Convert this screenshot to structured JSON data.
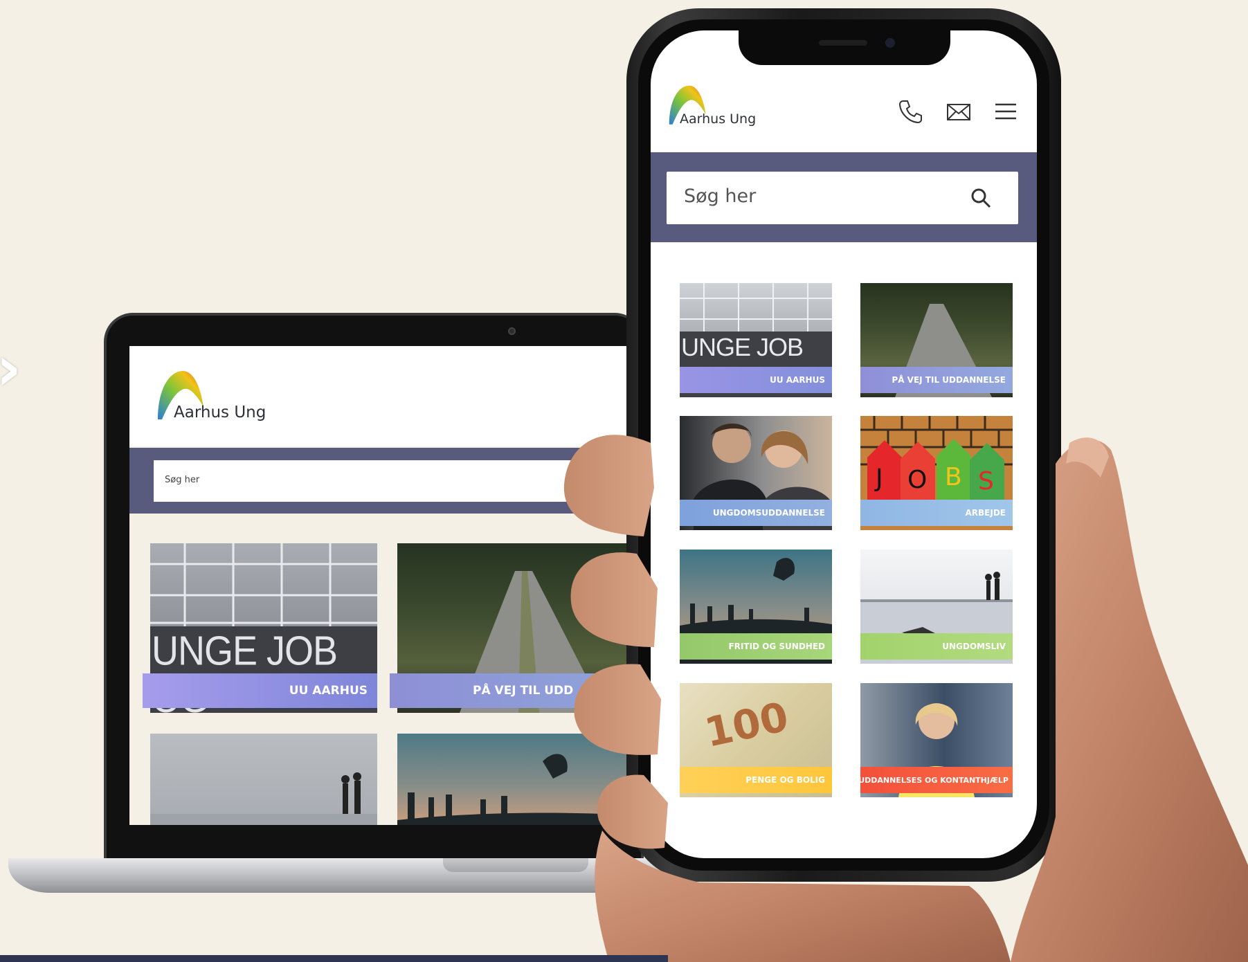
{
  "brand": {
    "name": "Aarhus Ung"
  },
  "laptop": {
    "search_placeholder": "Søg her",
    "tiles": [
      {
        "label": "UU AARHUS",
        "sign": "UNGE JOB OG"
      },
      {
        "label": "PÅ VEJ TIL UDD"
      }
    ]
  },
  "phone": {
    "search_placeholder": "Søg her",
    "tiles": [
      {
        "label": "UU AARHUS",
        "sign": "UNGE JOB OG"
      },
      {
        "label": "PÅ VEJ TIL UDDANNELSE"
      },
      {
        "label": "UNGDOMSUDDANNELSE"
      },
      {
        "label": "ARBEJDE",
        "tags": [
          "J",
          "O",
          "B",
          "S"
        ]
      },
      {
        "label": "FRITID OG SUNDHED"
      },
      {
        "label": "UNGDOMSLIV"
      },
      {
        "label": "PENGE OG BOLIG",
        "note": "100"
      },
      {
        "label": "UDDANNELSES OG KONTANTHJÆLP"
      }
    ]
  },
  "colors": {
    "background": "#f5f0e6",
    "search_band": "#585b7e",
    "label_purple": "#8b86e0",
    "label_blue": "#86a8dc",
    "label_green": "#a6d36e",
    "label_yellow": "#ffcf4a",
    "label_red": "#f7543a"
  }
}
